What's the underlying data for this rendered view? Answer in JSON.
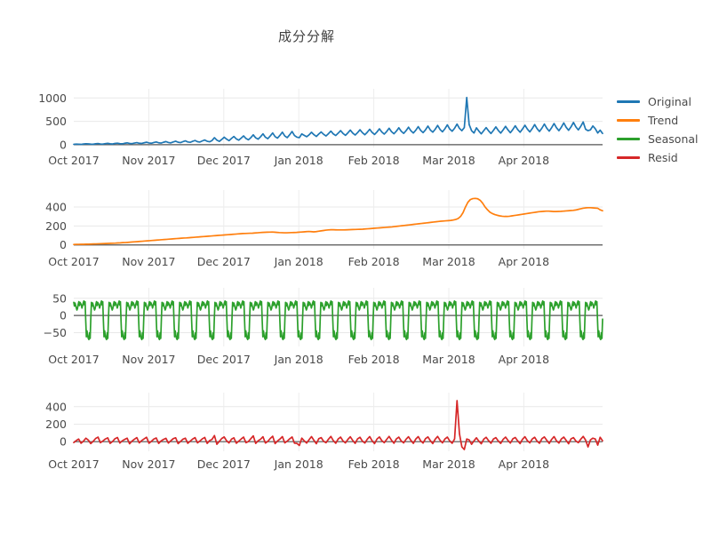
{
  "chart_title": "成分分解",
  "legend": {
    "position": "right",
    "items": [
      {
        "label": "Original",
        "color": "#1f77b4"
      },
      {
        "label": "Trend",
        "color": "#ff7f0e"
      },
      {
        "label": "Seasonal",
        "color": "#2ca02c"
      },
      {
        "label": "Resid",
        "color": "#d62728"
      }
    ]
  },
  "chart_data": {
    "type": "line",
    "title": "成分分解",
    "subtitle": "",
    "xlabel": "",
    "ylabel": "",
    "grid": true,
    "legend_position": "right",
    "x_tick_labels": [
      "Oct 2017",
      "Nov 2017",
      "Dec 2017",
      "Jan 2018",
      "Feb 2018",
      "Mar 2018",
      "Apr 2018"
    ],
    "x_range": [
      "2017-10-01",
      "2018-04-30"
    ],
    "panels": [
      {
        "name": "Original",
        "color": "#1f77b4",
        "ylim": [
          -60,
          1120
        ],
        "y_ticks": [
          0,
          500,
          1000
        ],
        "values": [
          8,
          12,
          10,
          6,
          14,
          20,
          16,
          11,
          9,
          18,
          24,
          15,
          12,
          22,
          28,
          19,
          14,
          26,
          32,
          21,
          18,
          30,
          38,
          26,
          22,
          34,
          44,
          30,
          26,
          40,
          52,
          36,
          30,
          46,
          58,
          40,
          34,
          52,
          66,
          46,
          38,
          58,
          74,
          52,
          44,
          64,
          82,
          58,
          50,
          72,
          90,
          64,
          56,
          80,
          100,
          72,
          62,
          88,
          150,
          96,
          70,
          112,
          160,
          118,
          86,
          132,
          176,
          124,
          96,
          140,
          188,
          132,
          104,
          150,
          210,
          146,
          118,
          170,
          232,
          160,
          128,
          186,
          250,
          172,
          140,
          200,
          268,
          186,
          150,
          212,
          282,
          196,
          160,
          150,
          230,
          200,
          170,
          210,
          266,
          214,
          176,
          228,
          272,
          222,
          186,
          236,
          290,
          230,
          196,
          246,
          300,
          240,
          200,
          252,
          312,
          248,
          206,
          258,
          320,
          256,
          212,
          266,
          330,
          262,
          218,
          272,
          340,
          270,
          226,
          282,
          352,
          278,
          234,
          290,
          362,
          288,
          242,
          300,
          374,
          296,
          250,
          310,
          386,
          306,
          258,
          318,
          398,
          314,
          268,
          330,
          412,
          326,
          276,
          340,
          424,
          334,
          288,
          352,
          440,
          348,
          300,
          366,
          1010,
          430,
          300,
          250,
          360,
          292,
          232,
          300,
          366,
          296,
          240,
          306,
          380,
          306,
          248,
          316,
          392,
          316,
          256,
          324,
          404,
          324,
          266,
          336,
          416,
          334,
          274,
          344,
          430,
          344,
          282,
          354,
          442,
          352,
          290,
          364,
          452,
          362,
          300,
          374,
          466,
          372,
          308,
          382,
          476,
          380,
          316,
          392,
          486,
          330,
          300,
          318,
          400,
          340,
          250,
          310,
          240
        ]
      },
      {
        "name": "Trend",
        "color": "#ff7f0e",
        "ylim": [
          -40,
          540
        ],
        "y_ticks": [
          0,
          200,
          400
        ],
        "values": [
          5,
          6,
          6,
          7,
          7,
          8,
          8,
          9,
          10,
          11,
          12,
          13,
          14,
          15,
          16,
          17,
          18,
          19,
          21,
          22,
          24,
          25,
          27,
          29,
          31,
          33,
          35,
          37,
          39,
          41,
          43,
          45,
          47,
          49,
          51,
          53,
          55,
          57,
          59,
          61,
          63,
          65,
          67,
          69,
          71,
          73,
          74,
          76,
          78,
          80,
          82,
          84,
          86,
          88,
          90,
          92,
          94,
          96,
          98,
          100,
          102,
          104,
          106,
          108,
          110,
          112,
          114,
          116,
          118,
          120,
          121,
          122,
          123,
          124,
          126,
          128,
          130,
          132,
          133,
          134,
          135,
          136,
          134,
          132,
          130,
          129,
          128,
          128,
          129,
          130,
          131,
          132,
          134,
          136,
          138,
          140,
          142,
          140,
          138,
          140,
          144,
          148,
          152,
          156,
          158,
          160,
          160,
          159,
          158,
          158,
          158,
          159,
          160,
          161,
          162,
          163,
          164,
          165,
          166,
          168,
          170,
          172,
          174,
          176,
          178,
          180,
          182,
          184,
          186,
          188,
          190,
          193,
          196,
          199,
          202,
          205,
          208,
          211,
          214,
          217,
          220,
          223,
          226,
          229,
          232,
          235,
          238,
          241,
          244,
          247,
          250,
          252,
          254,
          256,
          258,
          262,
          268,
          278,
          300,
          340,
          400,
          450,
          478,
          488,
          490,
          486,
          470,
          440,
          400,
          370,
          345,
          330,
          320,
          312,
          306,
          302,
          300,
          300,
          302,
          306,
          310,
          314,
          318,
          322,
          326,
          330,
          334,
          338,
          342,
          346,
          350,
          352,
          354,
          356,
          356,
          354,
          352,
          352,
          353,
          354,
          356,
          358,
          360,
          362,
          364,
          368,
          374,
          380,
          386,
          390,
          392,
          392,
          390,
          388,
          386,
          370,
          360
        ]
      },
      {
        "name": "Seasonal",
        "color": "#2ca02c",
        "ylim": [
          -90,
          70
        ],
        "y_ticks": [
          -50,
          0,
          50
        ],
        "weekly_pattern": [
          38,
          22,
          40,
          30,
          42,
          -62,
          -70
        ],
        "description": "Weekly cycle: double-humped peak near +40 on weekdays, deep trough near -65 on weekend days"
      },
      {
        "name": "Resid",
        "color": "#d62728",
        "ylim": [
          -110,
          520
        ],
        "y_ticks": [
          0,
          200,
          400
        ],
        "values": [
          -10,
          12,
          30,
          -18,
          6,
          40,
          18,
          -22,
          4,
          36,
          52,
          -12,
          8,
          30,
          44,
          -20,
          2,
          34,
          48,
          -16,
          10,
          26,
          40,
          -24,
          6,
          28,
          46,
          -14,
          12,
          32,
          50,
          -18,
          4,
          30,
          42,
          -20,
          8,
          26,
          38,
          -16,
          10,
          34,
          44,
          -22,
          2,
          28,
          40,
          -18,
          6,
          30,
          46,
          -14,
          8,
          32,
          48,
          -20,
          12,
          26,
          70,
          -30,
          4,
          36,
          54,
          10,
          -14,
          28,
          44,
          -18,
          6,
          30,
          52,
          -12,
          2,
          34,
          66,
          -20,
          10,
          28,
          56,
          -16,
          4,
          36,
          62,
          -22,
          8,
          30,
          58,
          -14,
          6,
          32,
          54,
          -18,
          -20,
          -44,
          40,
          10,
          -16,
          22,
          58,
          16,
          -24,
          34,
          46,
          4,
          -12,
          28,
          60,
          12,
          -18,
          30,
          52,
          8,
          -14,
          26,
          56,
          14,
          -20,
          32,
          50,
          6,
          -16,
          28,
          58,
          10,
          -22,
          30,
          54,
          12,
          -12,
          26,
          60,
          16,
          -18,
          32,
          52,
          8,
          -14,
          28,
          56,
          14,
          -20,
          30,
          58,
          10,
          -16,
          34,
          54,
          12,
          -22,
          28,
          60,
          16,
          -14,
          30,
          52,
          8,
          -18,
          32,
          470,
          90,
          -60,
          -90,
          30,
          20,
          -30,
          10,
          44,
          6,
          -24,
          28,
          50,
          12,
          -18,
          30,
          46,
          8,
          -20,
          26,
          52,
          14,
          -16,
          32,
          48,
          10,
          -22,
          28,
          56,
          12,
          -14,
          30,
          50,
          6,
          -18,
          34,
          54,
          16,
          -20,
          26,
          58,
          10,
          -16,
          30,
          52,
          14,
          -24,
          32,
          46,
          8,
          -12,
          28,
          60,
          18,
          -60,
          20,
          40,
          30,
          -40,
          50,
          10
        ]
      }
    ]
  }
}
